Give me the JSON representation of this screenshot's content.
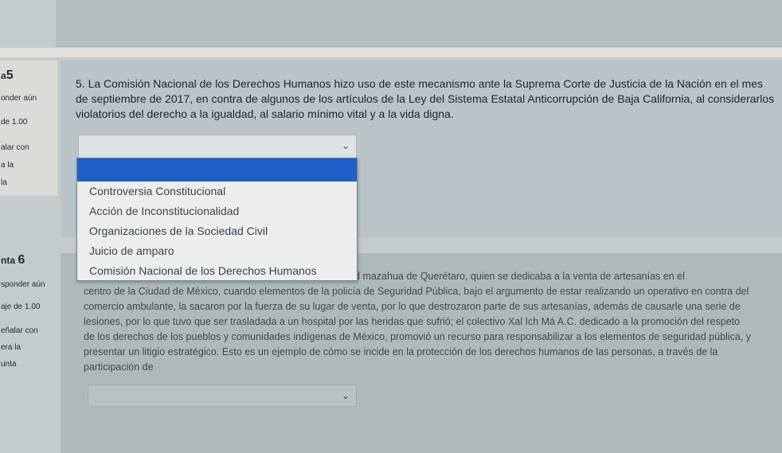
{
  "q5_info": {
    "number_prefix": "a",
    "number": "5",
    "status": "onder aún",
    "points": "de 1.00",
    "flag_line1": "alar con",
    "flag_line2": "a la",
    "flag_line3": "la"
  },
  "q5": {
    "text": "5. La Comisión Nacional de los Derechos Humanos hizo uso de este mecanismo ante la Suprema Corte de Justicia de la Nación en el mes de septiembre de 2017, en contra de algunos de los artículos de la Ley del Sistema Estatal Anticorrupción de Baja California, al considerarlos violatorios del derecho a la igualdad, al salario mínimo vital y a la vida digna.",
    "select_value": "",
    "options": [
      "",
      "Controversia Constitucional",
      "Acción de Inconstitucionalidad",
      "Organizaciones de la Sociedad Civil",
      "Juicio de amparo",
      "Comisión Nacional de los Derechos Humanos"
    ]
  },
  "q6_info": {
    "number_prefix": "nta",
    "number": "6",
    "status": "sponder aún",
    "points": "aje de 1.00",
    "flag_line1": "eñalar con",
    "flag_line2": "era la",
    "flag_line3": "unta"
  },
  "q6": {
    "line1_visible": "d mazahua de Querétaro, quien se dedicaba a la venta de artesanías en el",
    "rest": "centro de la Ciudad de México, cuando elementos de la policía de Seguridad Pública, bajo el argumento de estar realizando un operativo en contra del comercio ambulante, la sacaron por la fuerza de su lugar de venta, por lo que destrozaron parte de sus artesanías, además de causarle una serie de lesiones, por lo que tuvo que ser trasladada a un hospital por las heridas que sufrió; el colectivo Xal Ich Má A.C. dedicado a la promoción del respeto de los derechos de los pueblos y comunidades indígenas de México, promovió un recurso para responsabilizar a los elementos de seguridad pública, y presentar un litigio estratégico. Esto es un ejemplo de cómo se incide en la protección de los derechos humanos de las personas, a través de la participación de",
    "select_value": ""
  }
}
